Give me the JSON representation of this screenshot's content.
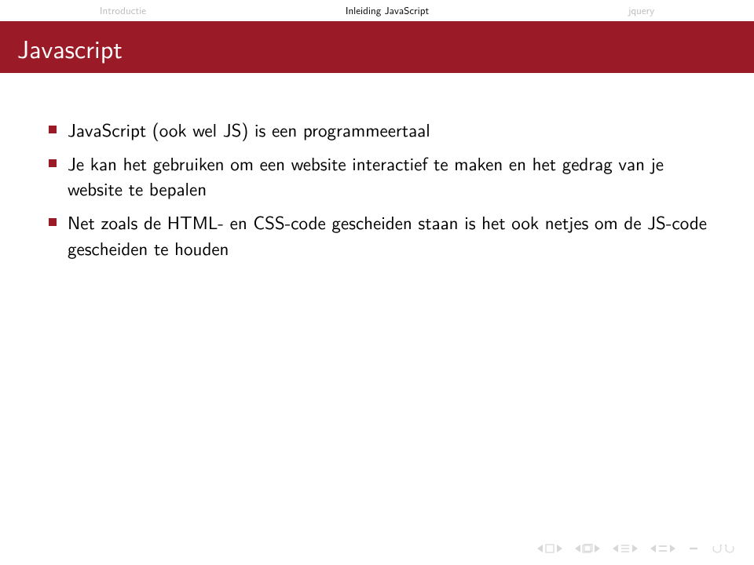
{
  "nav": {
    "items": [
      {
        "label": "Introductie",
        "active": false
      },
      {
        "label": "Inleiding JavaScript",
        "active": true
      },
      {
        "label": "jquery",
        "active": false
      }
    ]
  },
  "title": "Javascript",
  "bullets": [
    "JavaScript (ook wel JS) is een programmeertaal",
    "Je kan het gebruiken om een website interactief te maken en het gedrag van je website te bepalen",
    "Net zoals de HTML- en CSS-code gescheiden staan is het ook netjes om de JS-code gescheiden te houden"
  ]
}
